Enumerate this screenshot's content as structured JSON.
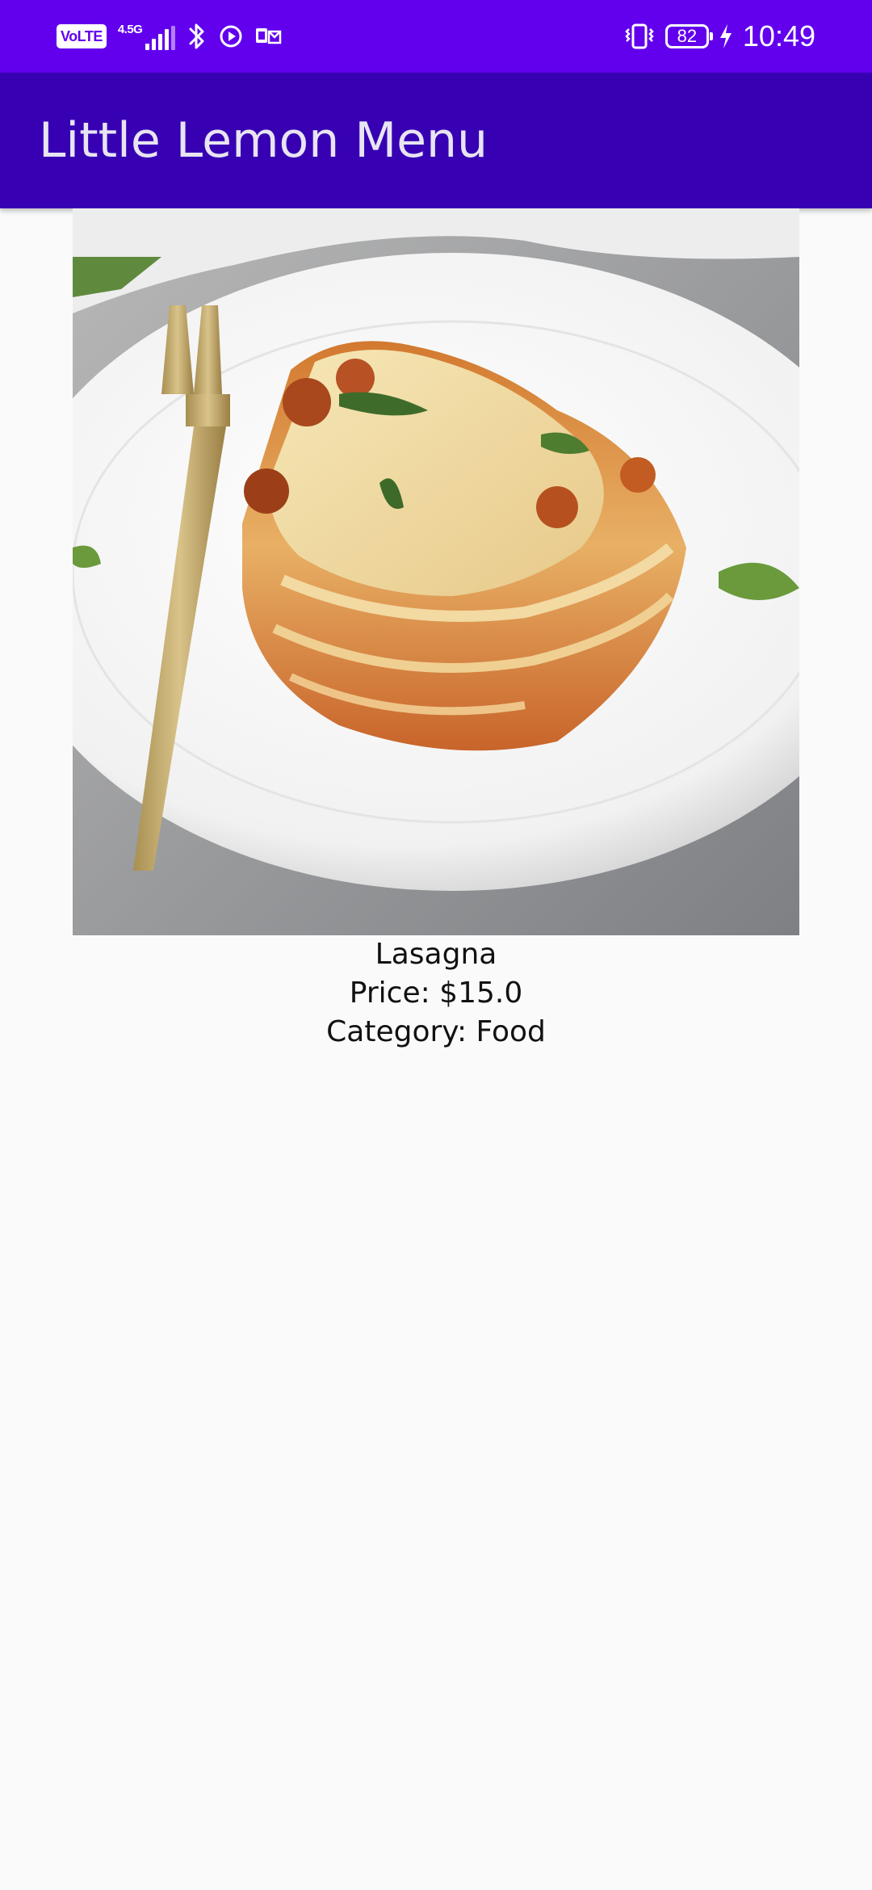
{
  "status_bar": {
    "volte": "VoLTE",
    "network_type": "4.5G",
    "battery_level": "82",
    "time": "10:49",
    "icons": [
      "volte-icon",
      "signal-icon",
      "bluetooth-icon",
      "media-play-icon",
      "notification-icon",
      "vibrate-icon",
      "battery-icon",
      "charging-icon"
    ]
  },
  "app_bar": {
    "title": "Little Lemon Menu",
    "background": "#3700b3"
  },
  "colors": {
    "status_bar": "#6200ee",
    "app_bar": "#3700b3",
    "background": "#fafafa"
  },
  "dish": {
    "image": "lasagna-photo",
    "name": "Lasagna",
    "price": "Price: $15.0",
    "category": "Category: Food"
  }
}
